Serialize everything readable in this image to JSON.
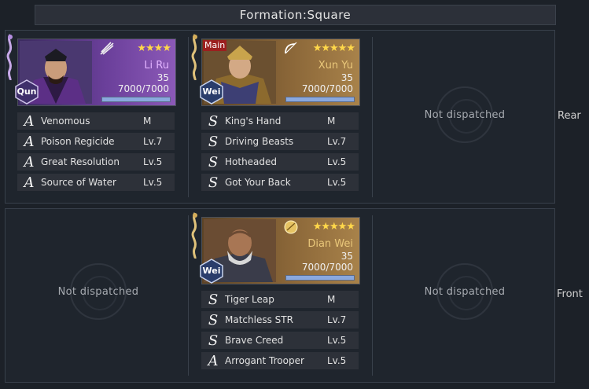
{
  "title": "Formation:Square",
  "rows": {
    "rear": {
      "label": "Rear"
    },
    "front": {
      "label": "Front"
    }
  },
  "empty_label": "Not dispatched",
  "generals": [
    {
      "name": "Li Ru",
      "faction": "Qun",
      "stars": "★★★★",
      "level": "35",
      "troops": "7000/7000",
      "troops_fraction": 1.0,
      "weapon": "fan-icon",
      "main": "",
      "skills": [
        {
          "grade": "A",
          "name": "Venomous",
          "level": "M"
        },
        {
          "grade": "A",
          "name": "Poison Regicide",
          "level": "Lv.7"
        },
        {
          "grade": "A",
          "name": "Great Resolution",
          "level": "Lv.5"
        },
        {
          "grade": "A",
          "name": "Source of Water",
          "level": "Lv.5"
        }
      ]
    },
    {
      "name": "Xun Yu",
      "faction": "Wei",
      "stars": "★★★★★",
      "level": "35",
      "troops": "7000/7000",
      "troops_fraction": 1.0,
      "weapon": "bow-icon",
      "main": "Main",
      "skills": [
        {
          "grade": "S",
          "name": "King's Hand",
          "level": "M"
        },
        {
          "grade": "S",
          "name": "Driving Beasts",
          "level": "Lv.7"
        },
        {
          "grade": "S",
          "name": "Hotheaded",
          "level": "Lv.5"
        },
        {
          "grade": "S",
          "name": "Got Your Back",
          "level": "Lv.5"
        }
      ]
    },
    {
      "name": "Dian Wei",
      "faction": "Wei",
      "stars": "★★★★★",
      "level": "35",
      "troops": "7000/7000",
      "troops_fraction": 1.0,
      "weapon": "shield-icon",
      "main": "",
      "skills": [
        {
          "grade": "S",
          "name": "Tiger Leap",
          "level": "M"
        },
        {
          "grade": "S",
          "name": "Matchless STR",
          "level": "Lv.7"
        },
        {
          "grade": "S",
          "name": "Brave Creed",
          "level": "Lv.5"
        },
        {
          "grade": "A",
          "name": "Arrogant Trooper",
          "level": "Lv.5"
        }
      ]
    }
  ],
  "colors": {
    "star": "#ffd84a",
    "name_gold": "#e9c77a",
    "name_purple": "#e2b3ff",
    "main_tag": "#9b1f1f"
  }
}
